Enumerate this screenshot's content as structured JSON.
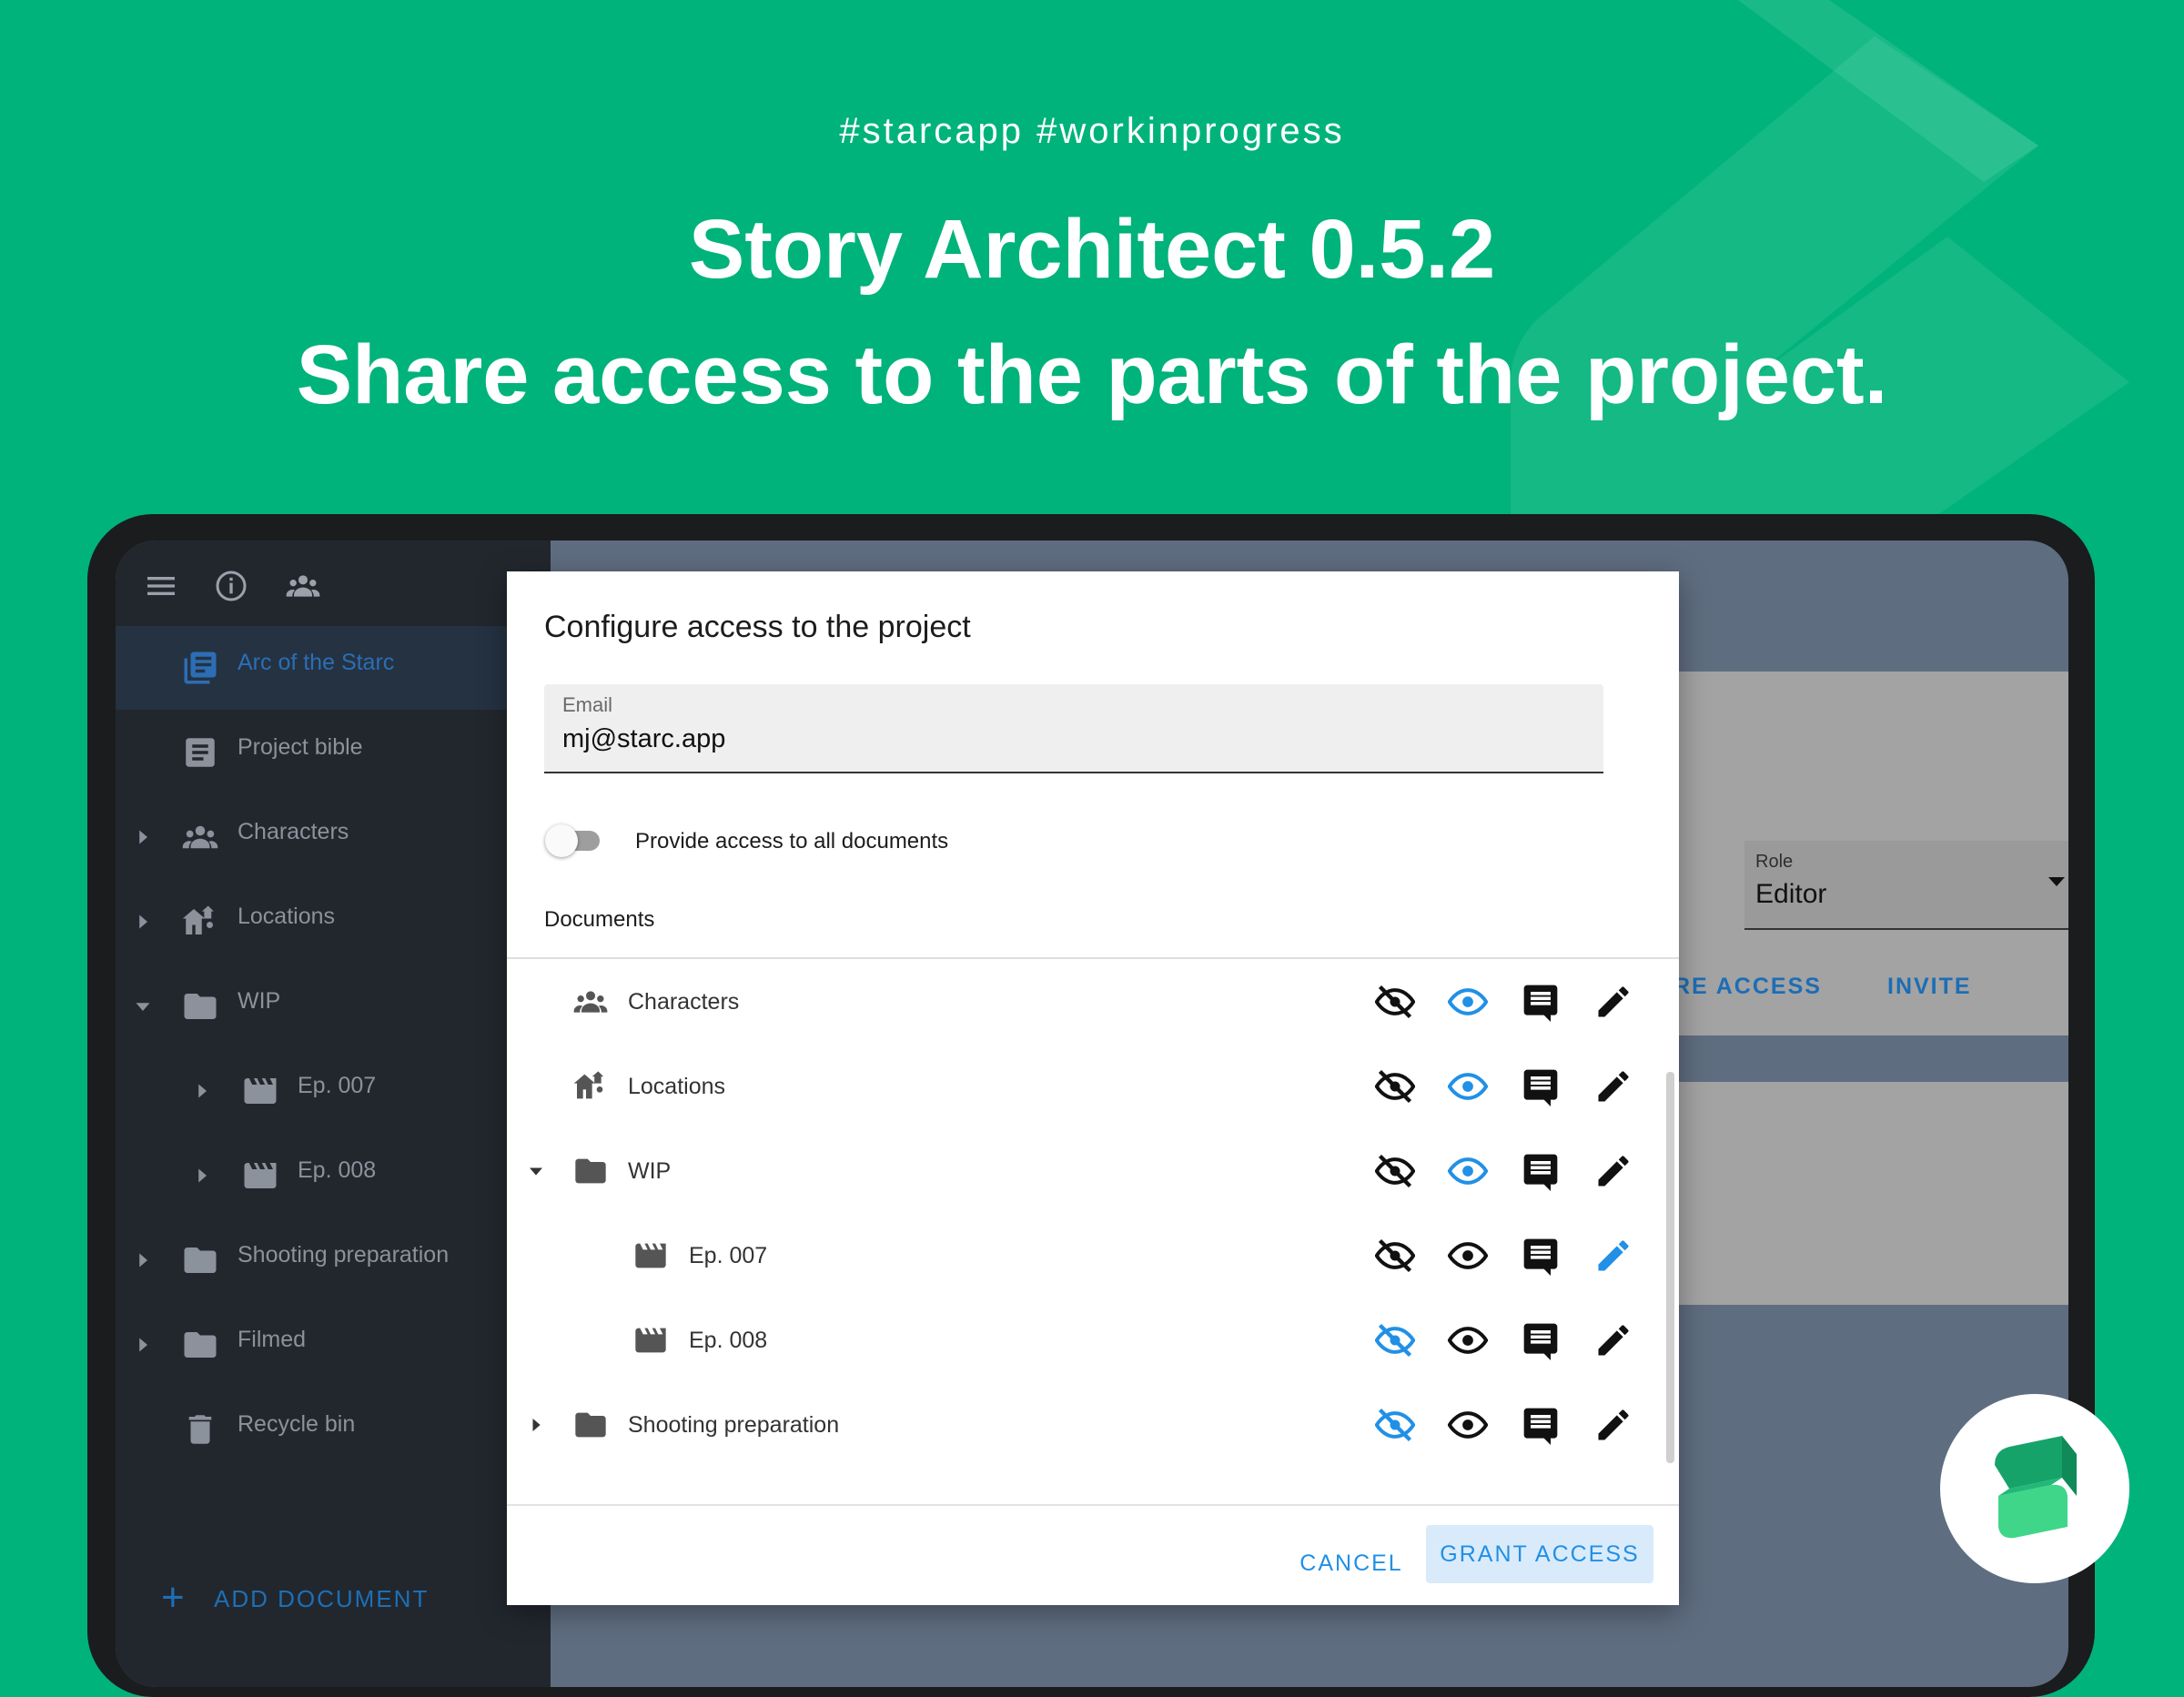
{
  "promo": {
    "hashtags": "#starcapp  #workinprogress",
    "title": "Story Architect 0.5.2",
    "subtitle": "Share access to the parts of the project."
  },
  "colors": {
    "background": "#00b37a",
    "accent": "#2190e6",
    "sidebar": "#22272e"
  },
  "sidebar": {
    "toolbar_icons": [
      "menu-icon",
      "info-icon",
      "people-icon"
    ],
    "items": [
      {
        "label": "Arc of the Starc",
        "icon": "project-icon",
        "active": true
      },
      {
        "label": "Project bible",
        "icon": "document-icon"
      },
      {
        "label": "Characters",
        "icon": "people-icon",
        "expandable": true
      },
      {
        "label": "Locations",
        "icon": "location-icon",
        "expandable": true
      },
      {
        "label": "WIP",
        "icon": "folder-icon",
        "expanded": true
      },
      {
        "label": "Ep. 007",
        "icon": "clapperboard-icon",
        "expandable": true
      },
      {
        "label": "Ep. 008",
        "icon": "clapperboard-icon",
        "expandable": true
      },
      {
        "label": "Shooting preparation",
        "icon": "folder-icon",
        "expandable": true
      },
      {
        "label": "Filmed",
        "icon": "folder-icon",
        "expandable": true
      },
      {
        "label": "Recycle bin",
        "icon": "trash-icon"
      }
    ],
    "add_document": "ADD DOCUMENT"
  },
  "background_panel": {
    "role_label": "Role",
    "role_value": "Editor",
    "configure_access_partial": "RE ACCESS",
    "invite": "INVITE"
  },
  "dialog": {
    "title": "Configure access to the project",
    "email_label": "Email",
    "email_value": "mj@starc.app",
    "toggle_label": "Provide access to all documents",
    "toggle_on": false,
    "documents_label": "Documents",
    "rows": [
      {
        "label": "Characters",
        "icon": "people-icon",
        "selected": "read"
      },
      {
        "label": "Locations",
        "icon": "location-icon",
        "selected": "read"
      },
      {
        "label": "WIP",
        "icon": "folder-icon",
        "expanded": true,
        "selected": "read"
      },
      {
        "label": "Ep. 007",
        "icon": "clapperboard-icon",
        "selected": "edit"
      },
      {
        "label": "Ep. 008",
        "icon": "clapperboard-icon",
        "selected": "hidden"
      },
      {
        "label": "Shooting preparation",
        "icon": "folder-icon",
        "expandable": true,
        "selected": "hidden"
      }
    ],
    "cancel": "CANCEL",
    "grant": "GRANT ACCESS"
  }
}
